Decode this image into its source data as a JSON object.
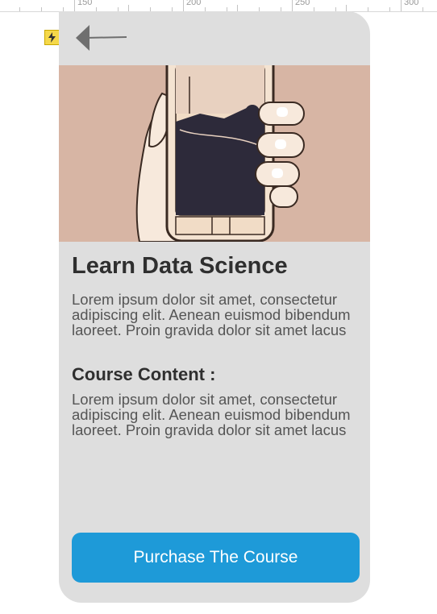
{
  "ruler": {
    "labels": [
      "150",
      "200",
      "250",
      "300"
    ]
  },
  "course": {
    "title": "Learn Data Science",
    "description": "Lorem ipsum dolor sit amet, consectetur adipiscing elit. Aenean euismod bibendum laoreet. Proin gravida dolor sit amet lacus",
    "content_heading": "Course Content :",
    "content_text": "Lorem ipsum dolor sit amet, consectetur adipiscing elit. Aenean euismod bibendum laoreet. Proin gravida dolor sit amet lacus"
  },
  "actions": {
    "purchase_label": "Purchase The Course"
  },
  "icons": {
    "back": "arrow-left-icon",
    "flash": "lightning-icon"
  },
  "colors": {
    "accent": "#1e9ad8",
    "card_bg": "#dedede",
    "hero_bg": "#d7b5a4",
    "title_text": "#2f2f2f",
    "body_text": "#555555"
  }
}
